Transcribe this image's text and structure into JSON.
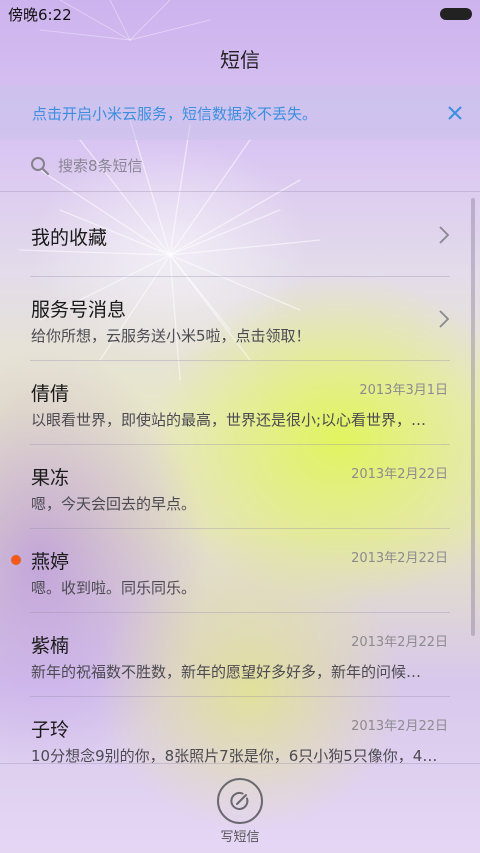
{
  "status_bar": {
    "time": "傍晚6:22"
  },
  "header": {
    "title": "短信"
  },
  "cloud_banner": {
    "text": "点击开启小米云服务，短信数据永不丢失。"
  },
  "search": {
    "placeholder": "搜索8条短信"
  },
  "conversations": [
    {
      "title": "我的收藏",
      "subtitle": "",
      "date": "",
      "chevron": true,
      "unread": false
    },
    {
      "title": "服务号消息",
      "subtitle": "给你所想，云服务送小米5啦，点击领取！",
      "date": "",
      "chevron": true,
      "unread": false
    },
    {
      "title": "倩倩",
      "subtitle": "以眼看世界，即使站的最高，世界还是很小;以心看世界，…",
      "date": "2013年3月1日",
      "chevron": false,
      "unread": false
    },
    {
      "title": "果冻",
      "subtitle": "嗯，今天会回去的早点。",
      "date": "2013年2月22日",
      "chevron": false,
      "unread": false
    },
    {
      "title": "燕婷",
      "subtitle": "嗯。收到啦。同乐同乐。",
      "date": "2013年2月22日",
      "chevron": false,
      "unread": true
    },
    {
      "title": "紫楠",
      "subtitle": "新年的祝福数不胜数，新年的愿望好多好多，新年的问候…",
      "date": "2013年2月22日",
      "chevron": false,
      "unread": false
    },
    {
      "title": "子玲",
      "subtitle": "10分想念9别的你，8张照片7张是你，6只小狗5只像你，4…",
      "date": "2013年2月22日",
      "chevron": false,
      "unread": false
    }
  ],
  "bottom_bar": {
    "compose_label": "写短信"
  },
  "colors": {
    "accent": "#3c8fe0",
    "unread_dot": "#f05a1a"
  },
  "icons": {
    "search": "search-icon",
    "close": "close-icon",
    "chevron": "chevron-right-icon",
    "compose": "compose-icon",
    "battery": "battery-icon"
  }
}
